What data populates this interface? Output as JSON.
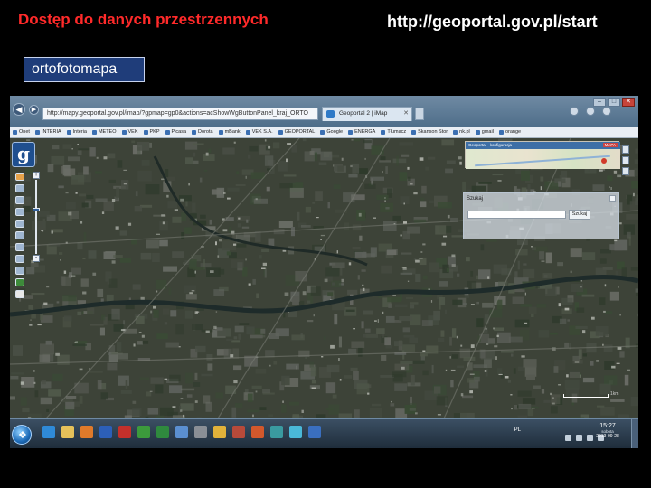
{
  "slide": {
    "title": "Dostęp do danych przestrzennych",
    "url": "http://geoportal.gov.pl/start",
    "label": "ortofotomapa",
    "title_color": "#ff2a2a"
  },
  "browser": {
    "address": "http://mapy.geoportal.gov.pl/imap/?gpmap=gp0&actions=acShowWgButtonPanel_kraj_ORTO",
    "tab_title": "Geoportal 2 | iMap",
    "bookmarks": [
      "Onet",
      "INTERIA",
      "Interia",
      "METEO",
      "VEK",
      "PKP",
      "Picasa",
      "Dorota",
      "mBank",
      "VEK S.A.",
      "GEOPORTAL",
      "Google",
      "ENERGA",
      "Tłumacz",
      "Skanson Stor",
      "nk.pl",
      "gmail",
      "orange"
    ]
  },
  "map": {
    "overview_title": "Geoportal - konfiguracja",
    "overview_badge": "MAPA",
    "search_label": "Szukaj",
    "search_value": "",
    "search_button": "Szukaj",
    "scale_text": "1km",
    "logo_letter": "g",
    "tools": [
      {
        "icon": "pan-hand-icon",
        "tone": "orange"
      },
      {
        "icon": "zoom-in-icon",
        "tone": "blue"
      },
      {
        "icon": "zoom-out-icon",
        "tone": "blue"
      },
      {
        "icon": "zoom-box-icon",
        "tone": "blue"
      },
      {
        "icon": "zoom-full-icon",
        "tone": "blue"
      },
      {
        "icon": "back-arrow-icon",
        "tone": "blue"
      },
      {
        "icon": "forward-arrow-icon",
        "tone": "blue"
      },
      {
        "icon": "info-icon",
        "tone": "blue"
      },
      {
        "icon": "ruler-icon",
        "tone": "blue"
      },
      {
        "icon": "print-icon",
        "tone": "green"
      },
      {
        "icon": "help-icon",
        "tone": "white"
      }
    ]
  },
  "taskbar": {
    "apps": [
      {
        "icon": "ie-icon",
        "color": "#2f8ad8"
      },
      {
        "icon": "explorer-icon",
        "color": "#e6c15a"
      },
      {
        "icon": "media-player-icon",
        "color": "#e07a2a"
      },
      {
        "icon": "word-icon",
        "color": "#2c5fb8"
      },
      {
        "icon": "pdf-icon",
        "color": "#c4302b"
      },
      {
        "icon": "app-green-icon",
        "color": "#3c9a3c"
      },
      {
        "icon": "excel-icon",
        "color": "#2f8a3e"
      },
      {
        "icon": "app-blue-icon",
        "color": "#5b8fd0"
      },
      {
        "icon": "app-gray-icon",
        "color": "#8a8f96"
      },
      {
        "icon": "app-yellow-icon",
        "color": "#e2b23a"
      },
      {
        "icon": "app-red-icon",
        "color": "#b84a3a"
      },
      {
        "icon": "powerpoint-icon",
        "color": "#d2582c"
      },
      {
        "icon": "app-teal-icon",
        "color": "#3a9aa0"
      },
      {
        "icon": "app-cyan-icon",
        "color": "#4ab8d8"
      },
      {
        "icon": "app-blue2-icon",
        "color": "#3a6fc0"
      }
    ],
    "lang": "PL",
    "time": "15:27",
    "day": "sobota",
    "date": "2013-09-28"
  }
}
